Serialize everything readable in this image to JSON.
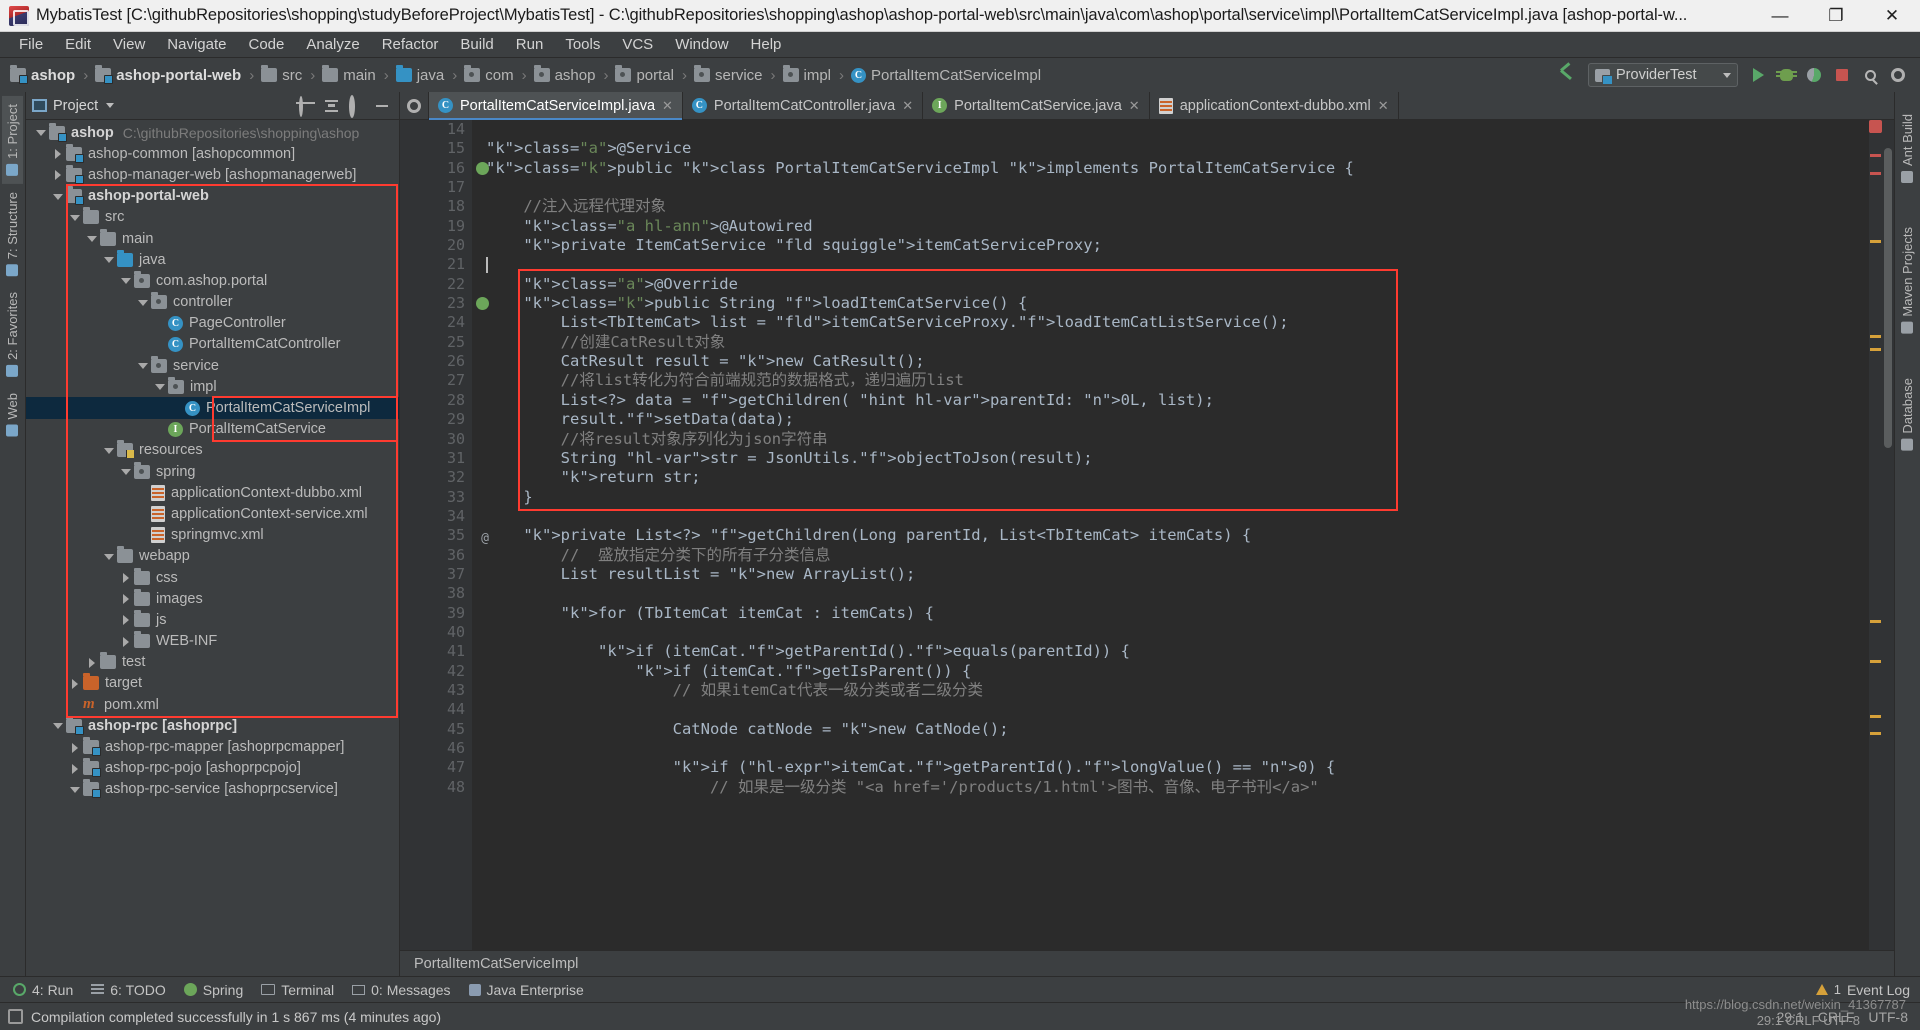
{
  "window": {
    "title": "MybatisTest [C:\\githubRepositories\\shopping\\studyBeforeProject\\MybatisTest] - C:\\githubRepositories\\shopping\\ashop\\ashop-portal-web\\src\\main\\java\\com\\ashop\\portal\\service\\impl\\PortalItemCatServiceImpl.java [ashop-portal-w...",
    "minimize": "—",
    "maximize": "❐",
    "close": "✕"
  },
  "menu": [
    "File",
    "Edit",
    "View",
    "Navigate",
    "Code",
    "Analyze",
    "Refactor",
    "Build",
    "Run",
    "Tools",
    "VCS",
    "Window",
    "Help"
  ],
  "navbar": {
    "crumbs": [
      {
        "label": "ashop",
        "icon": "module-folder-icon",
        "bold": true
      },
      {
        "label": "ashop-portal-web",
        "icon": "module-folder-icon",
        "bold": true
      },
      {
        "label": "src",
        "icon": "folder-icon",
        "bold": false
      },
      {
        "label": "main",
        "icon": "folder-icon",
        "bold": false
      },
      {
        "label": "java",
        "icon": "source-folder-icon",
        "bold": false
      },
      {
        "label": "com",
        "icon": "package-icon",
        "bold": false
      },
      {
        "label": "ashop",
        "icon": "package-icon",
        "bold": false
      },
      {
        "label": "portal",
        "icon": "package-icon",
        "bold": false
      },
      {
        "label": "service",
        "icon": "package-icon",
        "bold": false
      },
      {
        "label": "impl",
        "icon": "package-icon",
        "bold": false
      },
      {
        "label": "PortalItemCatServiceImpl",
        "icon": "class-icon",
        "bold": false
      }
    ],
    "run_configuration": "ProviderTest",
    "buttons": [
      "run-button",
      "debug-button",
      "coverage-button",
      "stop-button",
      "search-everywhere-button",
      "settings-button"
    ]
  },
  "left_tool_strip": [
    {
      "label": "1: Project",
      "name": "tool-window-project",
      "active": true
    },
    {
      "label": "7: Structure",
      "name": "tool-window-structure",
      "active": false
    },
    {
      "label": "2: Favorites",
      "name": "tool-window-favorites",
      "active": false
    },
    {
      "label": "Web",
      "name": "tool-window-web",
      "active": false
    }
  ],
  "right_tool_strip": [
    {
      "label": "Ant Build",
      "name": "tool-window-ant-build"
    },
    {
      "label": "Maven Projects",
      "name": "tool-window-maven-projects"
    },
    {
      "label": "Database",
      "name": "tool-window-database"
    }
  ],
  "project_panel": {
    "title": "Project",
    "actions": [
      "scroll-from-source-icon",
      "collapse-all-icon",
      "settings-gear-icon",
      "hide-icon"
    ],
    "tree": [
      {
        "depth": 0,
        "twist": "down",
        "icon": "module-folder-icon",
        "label": "ashop",
        "bold": true,
        "path": "C:\\githubRepositories\\shopping\\ashop"
      },
      {
        "depth": 1,
        "twist": "right",
        "icon": "module-folder-icon",
        "label": "ashop-common [ashopcommon]",
        "bold": false
      },
      {
        "depth": 1,
        "twist": "right",
        "icon": "module-folder-icon",
        "label": "ashop-manager-web [ashopmanagerweb]",
        "bold": false
      },
      {
        "depth": 1,
        "twist": "down",
        "icon": "module-folder-icon",
        "label": "ashop-portal-web",
        "bold": true
      },
      {
        "depth": 2,
        "twist": "down",
        "icon": "folder-icon",
        "label": "src",
        "bold": false
      },
      {
        "depth": 3,
        "twist": "down",
        "icon": "folder-icon",
        "label": "main",
        "bold": false
      },
      {
        "depth": 4,
        "twist": "down",
        "icon": "source-folder-icon",
        "label": "java",
        "bold": false
      },
      {
        "depth": 5,
        "twist": "down",
        "icon": "package-icon",
        "label": "com.ashop.portal",
        "bold": false
      },
      {
        "depth": 6,
        "twist": "down",
        "icon": "package-icon",
        "label": "controller",
        "bold": false
      },
      {
        "depth": 7,
        "twist": "none",
        "icon": "class-icon",
        "label": "PageController",
        "bold": false
      },
      {
        "depth": 7,
        "twist": "none",
        "icon": "class-icon",
        "label": "PortalItemCatController",
        "bold": false
      },
      {
        "depth": 6,
        "twist": "down",
        "icon": "package-icon",
        "label": "service",
        "bold": false
      },
      {
        "depth": 7,
        "twist": "down",
        "icon": "package-icon",
        "label": "impl",
        "bold": false
      },
      {
        "depth": 8,
        "twist": "none",
        "icon": "class-icon",
        "label": "PortalItemCatServiceImpl",
        "bold": false,
        "selected": true
      },
      {
        "depth": 7,
        "twist": "none",
        "icon": "interface-icon",
        "label": "PortalItemCatService",
        "bold": false
      },
      {
        "depth": 4,
        "twist": "down",
        "icon": "resources-folder-icon",
        "label": "resources",
        "bold": false
      },
      {
        "depth": 5,
        "twist": "down",
        "icon": "package-icon",
        "label": "spring",
        "bold": false
      },
      {
        "depth": 6,
        "twist": "none",
        "icon": "xml-file-icon",
        "label": "applicationContext-dubbo.xml",
        "bold": false
      },
      {
        "depth": 6,
        "twist": "none",
        "icon": "xml-file-icon",
        "label": "applicationContext-service.xml",
        "bold": false
      },
      {
        "depth": 6,
        "twist": "none",
        "icon": "xml-file-icon",
        "label": "springmvc.xml",
        "bold": false
      },
      {
        "depth": 4,
        "twist": "down",
        "icon": "folder-icon",
        "label": "webapp",
        "bold": false
      },
      {
        "depth": 5,
        "twist": "right",
        "icon": "folder-icon",
        "label": "css",
        "bold": false
      },
      {
        "depth": 5,
        "twist": "right",
        "icon": "folder-icon",
        "label": "images",
        "bold": false
      },
      {
        "depth": 5,
        "twist": "right",
        "icon": "folder-icon",
        "label": "js",
        "bold": false
      },
      {
        "depth": 5,
        "twist": "right",
        "icon": "folder-icon",
        "label": "WEB-INF",
        "bold": false
      },
      {
        "depth": 3,
        "twist": "right",
        "icon": "folder-icon",
        "label": "test",
        "bold": false
      },
      {
        "depth": 2,
        "twist": "right",
        "icon": "target-folder-icon",
        "label": "target",
        "bold": false
      },
      {
        "depth": 2,
        "twist": "none",
        "icon": "maven-pom-icon",
        "label": "pom.xml",
        "bold": false
      },
      {
        "depth": 1,
        "twist": "down",
        "icon": "module-folder-icon",
        "label": "ashop-rpc [ashoprpc]",
        "bold": true
      },
      {
        "depth": 2,
        "twist": "right",
        "icon": "module-folder-icon",
        "label": "ashop-rpc-mapper [ashoprpcmapper]",
        "bold": false
      },
      {
        "depth": 2,
        "twist": "right",
        "icon": "module-folder-icon",
        "label": "ashop-rpc-pojo [ashoprpcpojo]",
        "bold": false
      },
      {
        "depth": 2,
        "twist": "down",
        "icon": "module-folder-icon",
        "label": "ashop-rpc-service [ashoprpcservice]",
        "bold": false
      }
    ]
  },
  "editor": {
    "tabs": [
      {
        "label": "PortalItemCatServiceImpl.java",
        "icon": "class-icon",
        "active": true
      },
      {
        "label": "PortalItemCatController.java",
        "icon": "class-icon",
        "active": false
      },
      {
        "label": "PortalItemCatService.java",
        "icon": "interface-icon",
        "active": false
      },
      {
        "label": "applicationContext-dubbo.xml",
        "icon": "xml-file-icon",
        "active": false
      }
    ],
    "first_line_number": 14,
    "breadcrumb": "PortalItemCatServiceImpl",
    "lines": [
      {
        "n": 14,
        "code": ""
      },
      {
        "n": 15,
        "code": "@Service"
      },
      {
        "n": 16,
        "code": "public class PortalItemCatServiceImpl implements PortalItemCatService {"
      },
      {
        "n": 17,
        "code": ""
      },
      {
        "n": 18,
        "code": "    //注入远程代理对象"
      },
      {
        "n": 19,
        "code": "    @Autowired"
      },
      {
        "n": 20,
        "code": "    private ItemCatService itemCatServiceProxy;"
      },
      {
        "n": 21,
        "code": ""
      },
      {
        "n": 22,
        "code": "    @Override"
      },
      {
        "n": 23,
        "code": "    public String loadItemCatService() {"
      },
      {
        "n": 24,
        "code": "        List<TbItemCat> list = itemCatServiceProxy.loadItemCatListService();"
      },
      {
        "n": 25,
        "code": "        //创建CatResult对象"
      },
      {
        "n": 26,
        "code": "        CatResult result = new CatResult();"
      },
      {
        "n": 27,
        "code": "        //将list转化为符合前端规范的数据格式，递归遍历list"
      },
      {
        "n": 28,
        "code": "        List<?> data = getChildren( parentId: 0L, list);"
      },
      {
        "n": 29,
        "code": "        result.setData(data);"
      },
      {
        "n": 30,
        "code": "        //将result对象序列化为json字符串"
      },
      {
        "n": 31,
        "code": "        String str = JsonUtils.objectToJson(result);"
      },
      {
        "n": 32,
        "code": "        return str;"
      },
      {
        "n": 33,
        "code": "    }"
      },
      {
        "n": 34,
        "code": ""
      },
      {
        "n": 35,
        "code": "    private List<?> getChildren(Long parentId, List<TbItemCat> itemCats) {"
      },
      {
        "n": 36,
        "code": "        //  盛放指定分类下的所有子分类信息"
      },
      {
        "n": 37,
        "code": "        List resultList = new ArrayList();"
      },
      {
        "n": 38,
        "code": ""
      },
      {
        "n": 39,
        "code": "        for (TbItemCat itemCat : itemCats) {"
      },
      {
        "n": 40,
        "code": ""
      },
      {
        "n": 41,
        "code": "            if (itemCat.getParentId().equals(parentId)) {"
      },
      {
        "n": 42,
        "code": "                if (itemCat.getIsParent()) {"
      },
      {
        "n": 43,
        "code": "                    // 如果itemCat代表一级分类或者二级分类"
      },
      {
        "n": 44,
        "code": ""
      },
      {
        "n": 45,
        "code": "                    CatNode catNode = new CatNode();"
      },
      {
        "n": 46,
        "code": ""
      },
      {
        "n": 47,
        "code": "                    if (itemCat.getParentId().longValue() == 0) {"
      },
      {
        "n": 48,
        "code": "                        // 如果是一级分类 \"<a href='/products/1.html'>图书、音像、电子书刊</a>\""
      }
    ]
  },
  "bottom_toolwindows": [
    {
      "label": "4: Run",
      "prefix": "4:",
      "icon": "run-icon",
      "name": "tool-window-run"
    },
    {
      "label": "6: TODO",
      "prefix": "6:",
      "icon": "todo-icon",
      "name": "tool-window-todo"
    },
    {
      "label": "Spring",
      "prefix": "",
      "icon": "spring-icon",
      "name": "tool-window-spring"
    },
    {
      "label": "Terminal",
      "prefix": "",
      "icon": "terminal-icon",
      "name": "tool-window-terminal"
    },
    {
      "label": "0: Messages",
      "prefix": "0:",
      "icon": "messages-icon",
      "name": "tool-window-messages"
    },
    {
      "label": "Java Enterprise",
      "prefix": "",
      "icon": "jee-icon",
      "name": "tool-window-java-enterprise"
    }
  ],
  "event_log": "Event Log",
  "event_log_count": "1",
  "statusbar": {
    "message": "Compilation completed successfully in 1 s 867 ms (4 minutes ago)",
    "caret": "29:1",
    "encoding": "CRLF",
    "charset": "UTF-8"
  },
  "watermark": "https://blog.csdn.net/weixin_41367787",
  "colors": {
    "accent": "#4a88c7",
    "highlight_red": "#ff3b30",
    "selection_blue": "#0d293e",
    "editor_bg": "#2b2b2b",
    "panel_bg": "#3c3f41"
  }
}
